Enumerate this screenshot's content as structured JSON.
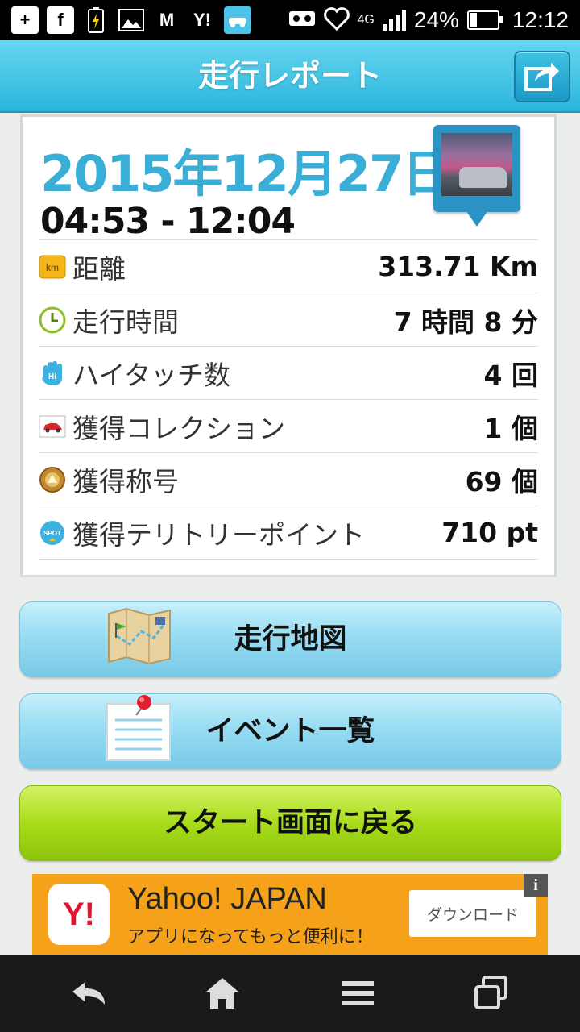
{
  "status_bar": {
    "left_icons": [
      "add-icon",
      "facebook-icon",
      "battery-charging-icon",
      "gallery-icon",
      "gmail-icon",
      "yahoo-icon",
      "minkara-icon"
    ],
    "yahoo_text": "Y!",
    "gmail_text": "M",
    "facebook_text": "f",
    "network": "4G",
    "battery": "24%",
    "battery_level": 0.24,
    "time": "12:12"
  },
  "header": {
    "title": "走行レポート",
    "share_icon": "share-icon"
  },
  "report": {
    "date": "2015年12月27日",
    "time_range": "04:53 - 12:04",
    "photo_icon": "photo-pin-icon",
    "rows": [
      {
        "icon": "km-icon",
        "icon_text": "km",
        "label": "距離",
        "value": "313.71 Km"
      },
      {
        "icon": "clock-icon",
        "label": "走行時間",
        "value": "7 時間 8 分"
      },
      {
        "icon": "hi-touch-icon",
        "icon_text": "Hi",
        "label": "ハイタッチ数",
        "value": "4 回"
      },
      {
        "icon": "car-collection-icon",
        "label": "獲得コレクション",
        "value": "1 個"
      },
      {
        "icon": "title-medal-icon",
        "label": "獲得称号",
        "value": "69 個"
      },
      {
        "icon": "spot-icon",
        "icon_text": "SPOT",
        "label": "獲得テリトリーポイント",
        "value": "710 pt"
      }
    ]
  },
  "buttons": {
    "map": "走行地図",
    "events": "イベント一覧",
    "back_to_start": "スタート画面に戻る"
  },
  "ad": {
    "logo_text": "Y!",
    "title": "Yahoo! JAPAN",
    "subtitle": "アプリになってもっと便利に！",
    "button": "ダウンロード",
    "info": "i"
  },
  "colors": {
    "accent": "#3aaed7",
    "header": "#2bb5dc",
    "green_button": "#a8dc1b",
    "ad_bg": "#f5a21a"
  }
}
